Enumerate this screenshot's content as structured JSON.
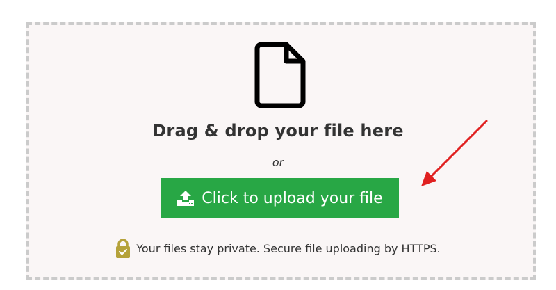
{
  "upload": {
    "heading": "Drag & drop your file here",
    "or_text": "or",
    "button_label": "Click to upload your file",
    "privacy_note": "Your files stay private. Secure file uploading by HTTPS."
  },
  "colors": {
    "button_bg": "#28a745",
    "dropzone_bg": "#faf6f6",
    "dropzone_border": "#cbcbcb",
    "lock_icon": "#b5a23a",
    "annotation_arrow": "#e02020"
  },
  "icons": {
    "file": "file-icon",
    "upload": "upload-icon",
    "lock": "lock-icon",
    "annotation": "red-arrow-icon"
  }
}
